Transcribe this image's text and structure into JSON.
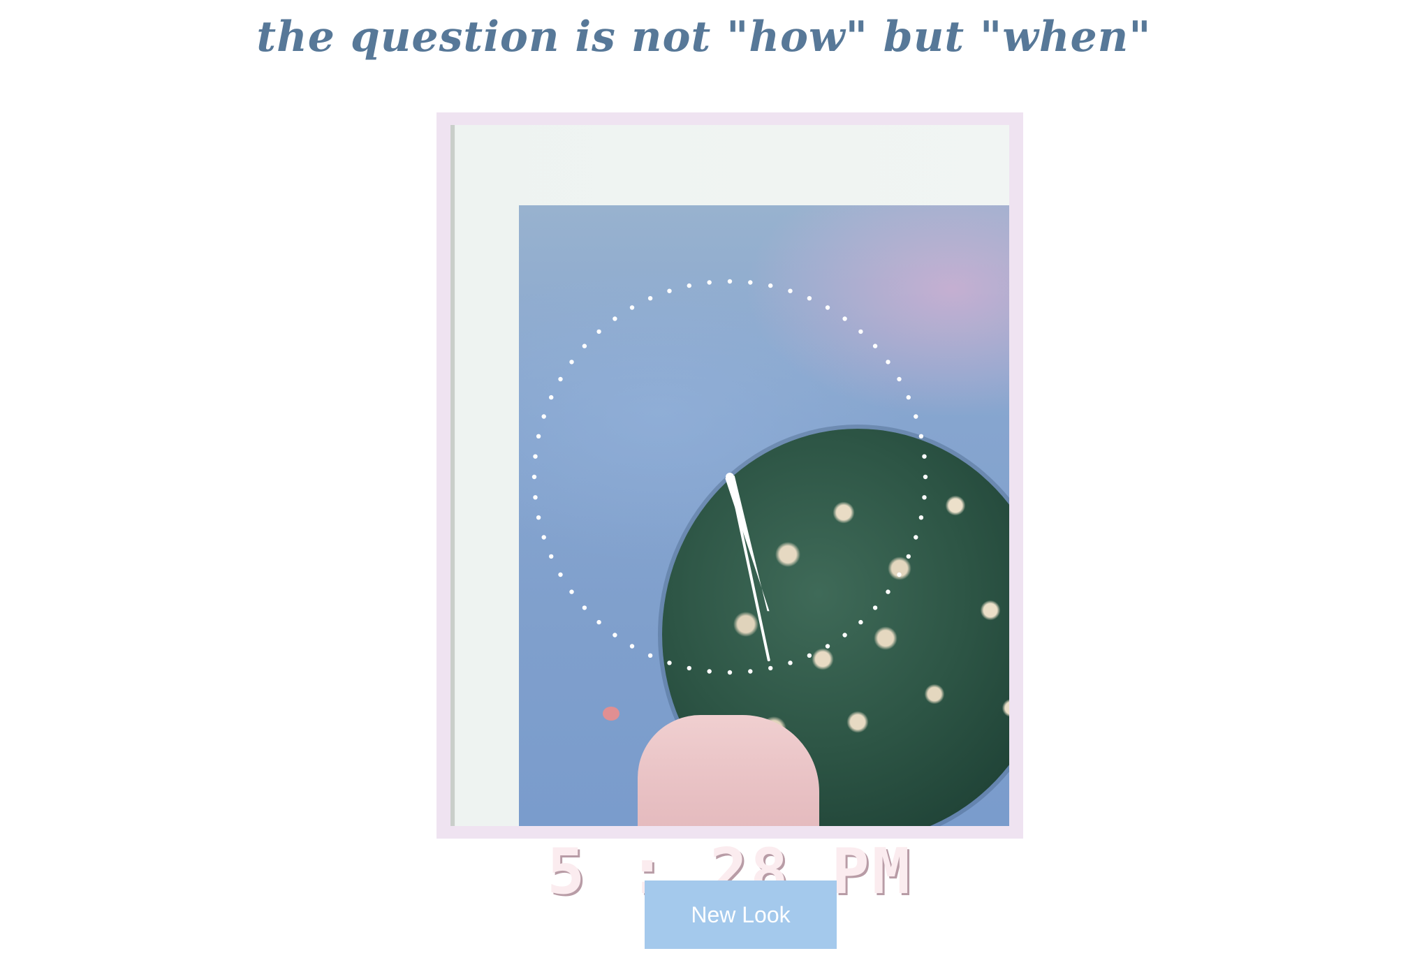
{
  "header": {
    "quote": "the question is not \"how\" but \"when\""
  },
  "clock": {
    "time_display": "5 : 28 PM",
    "hours": 5,
    "minutes": 28,
    "hand_color": "#ffffff",
    "dial_dot_color": "#ffffff"
  },
  "actions": {
    "new_look_label": "New Look"
  },
  "colors": {
    "headline": "#577898",
    "frame": "#efe3f1",
    "button": "#a4c9ec"
  }
}
